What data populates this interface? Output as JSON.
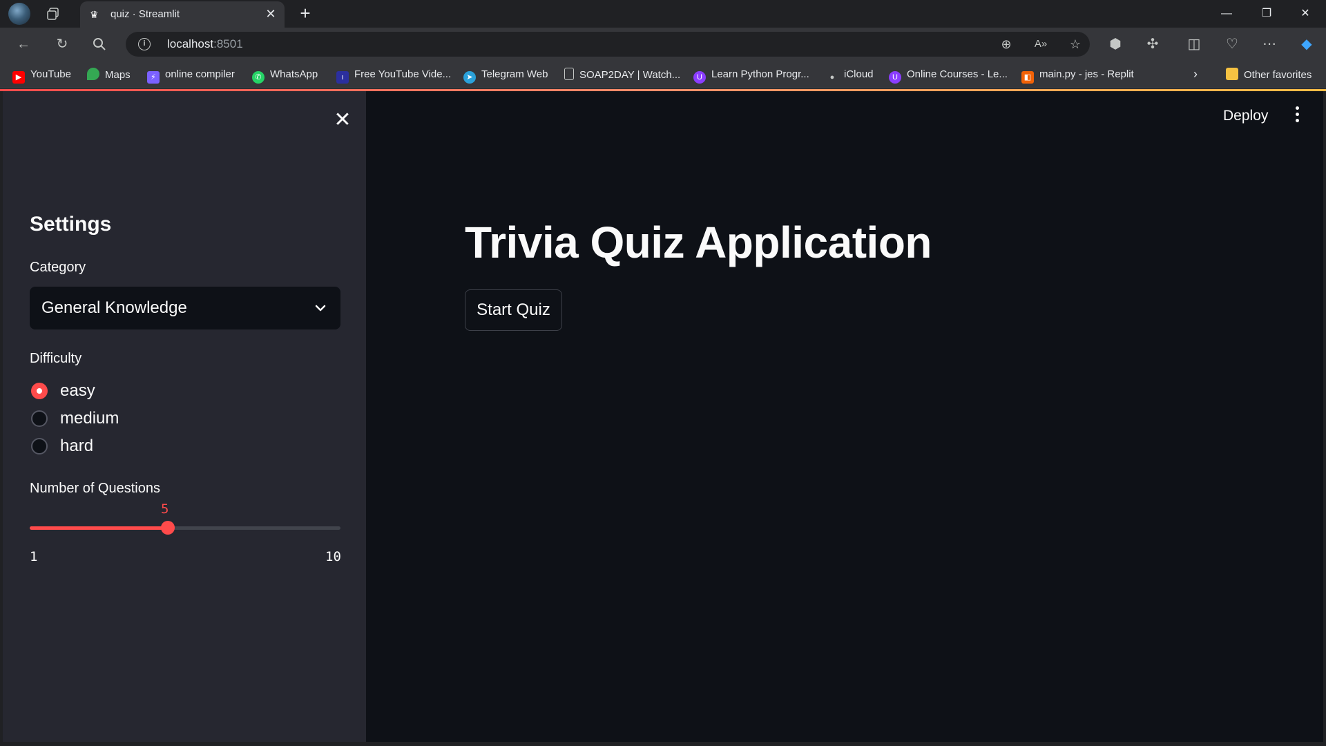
{
  "browser": {
    "tab_title": "quiz · Streamlit",
    "url_host": "localhost",
    "url_port": ":8501",
    "bookmarks": [
      {
        "label": "YouTube",
        "color": "#ff0000"
      },
      {
        "label": "Maps",
        "color": "#34a853"
      },
      {
        "label": "online compiler",
        "color": "#7b61ff"
      },
      {
        "label": "WhatsApp",
        "color": "#25d366"
      },
      {
        "label": "Free YouTube Vide...",
        "color": "#2b2f9e"
      },
      {
        "label": "Telegram Web",
        "color": "#2aa1da"
      },
      {
        "label": "SOAP2DAY | Watch...",
        "color": "#9aa0a6"
      },
      {
        "label": "Learn Python Progr...",
        "color": "#8b3dff"
      },
      {
        "label": "iCloud",
        "color": "#9aa0a6"
      },
      {
        "label": "Online Courses - Le...",
        "color": "#8b3dff"
      },
      {
        "label": "main.py - jes - Replit",
        "color": "#f26207"
      }
    ],
    "other_favorites": "Other favorites"
  },
  "app": {
    "deploy_label": "Deploy",
    "title": "Trivia Quiz Application",
    "start_button": "Start Quiz"
  },
  "sidebar": {
    "heading": "Settings",
    "category_label": "Category",
    "category_value": "General Knowledge",
    "difficulty_label": "Difficulty",
    "difficulty_options": [
      "easy",
      "medium",
      "hard"
    ],
    "difficulty_selected": "easy",
    "questions_label": "Number of Questions",
    "questions_value": "5",
    "questions_min": "1",
    "questions_max": "10"
  },
  "colors": {
    "accent": "#ff4b4b",
    "app_bg": "#0e1117",
    "sidebar_bg": "#262730"
  }
}
